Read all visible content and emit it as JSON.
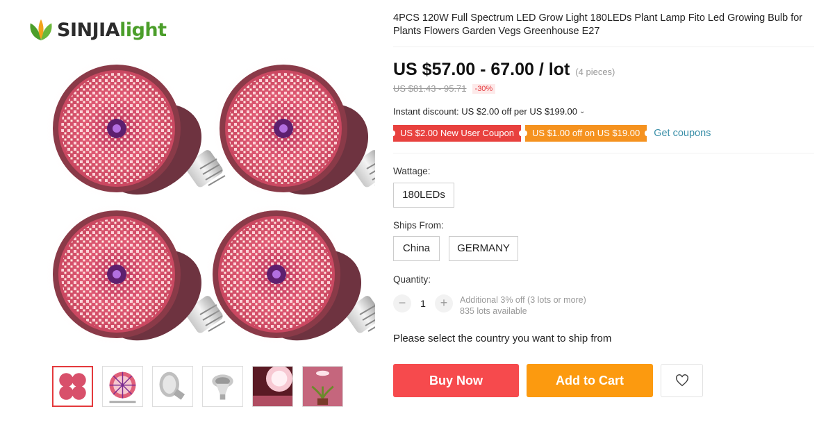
{
  "brand": {
    "name_dark": "SINJIA",
    "name_green": "light"
  },
  "product": {
    "title": "4PCS 120W Full Spectrum LED Grow Light 180LEDs Plant Lamp Fito Led Growing Bulb for Plants Flowers Garden Vegs Greenhouse E27"
  },
  "price": {
    "current": "US $57.00 - 67.00 / lot",
    "unit_note": "(4 pieces)",
    "original": "US $81.43 - 95.71",
    "discount": "-30%"
  },
  "instant_discount": "Instant discount: US $2.00 off per US $199.00",
  "coupons": {
    "new_user": "US $2.00 New User Coupon",
    "store": "US $1.00 off on US $19.00",
    "get_label": "Get coupons"
  },
  "wattage": {
    "label": "Wattage:",
    "options": [
      "180LEDs"
    ]
  },
  "ships_from": {
    "label": "Ships From:",
    "options": [
      "China",
      "GERMANY"
    ]
  },
  "quantity": {
    "label": "Quantity:",
    "value": "1",
    "minus": "−",
    "plus": "+",
    "note_line1": "Additional 3% off (3 lots or more)",
    "note_line2": "835 lots available"
  },
  "ship_message": "Please select the country you want to ship from",
  "actions": {
    "buy_now": "Buy Now",
    "add_to_cart": "Add to Cart"
  },
  "colors": {
    "buy_now": "#f64a4d",
    "add_to_cart": "#fc9a0f",
    "coupon_red": "#e8413e",
    "coupon_orange": "#f5921f",
    "link": "#3a8fa8",
    "brand_green": "#4b9e2a"
  }
}
